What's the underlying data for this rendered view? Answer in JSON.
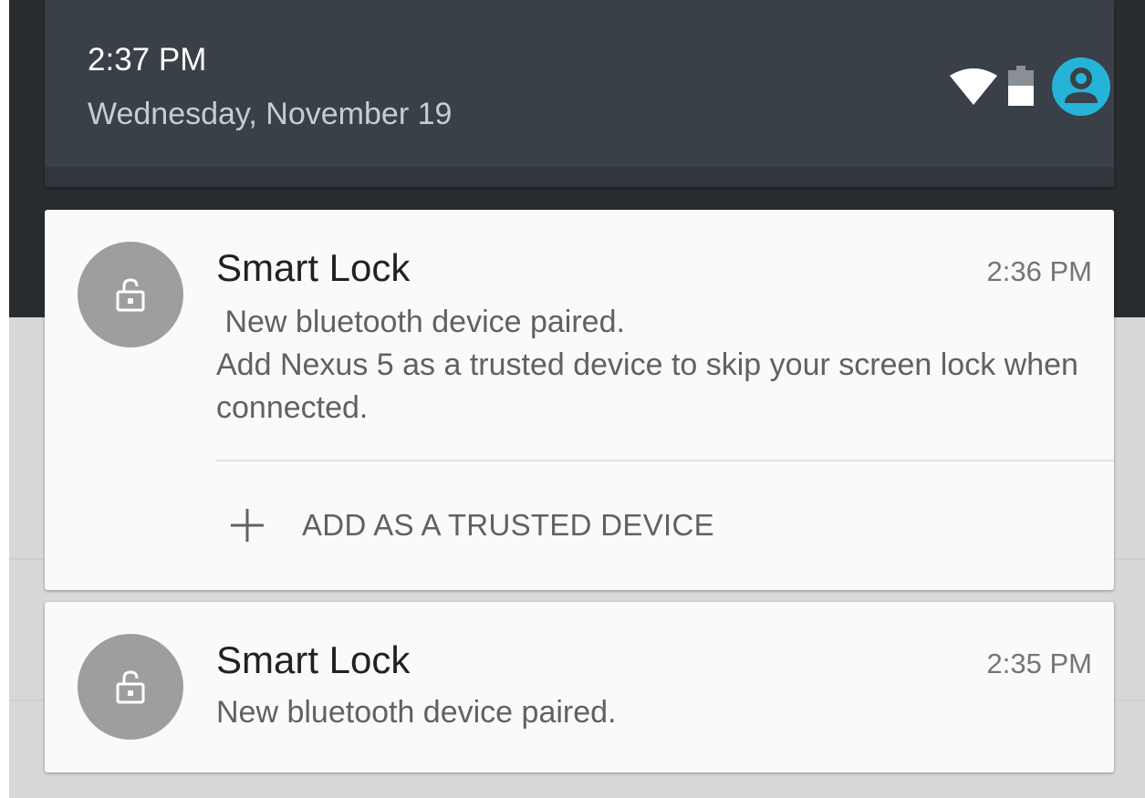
{
  "header": {
    "time": "2:37 PM",
    "date": "Wednesday, November 19",
    "icons": [
      "wifi-icon",
      "battery-icon",
      "user-avatar-icon"
    ],
    "accent_color": "#26b3d8"
  },
  "notifications": [
    {
      "app": "Smart Lock",
      "time": "2:36 PM",
      "icon": "unlocked-padlock-icon",
      "line1": " New bluetooth device paired.",
      "line2": "Add Nexus 5 as a trusted device to skip your screen lock when connected.",
      "action": {
        "icon": "plus-icon",
        "label": "ADD AS A TRUSTED DEVICE"
      }
    },
    {
      "app": "Smart Lock",
      "time": "2:35 PM",
      "icon": "unlocked-padlock-icon",
      "line1": "New bluetooth device paired."
    }
  ]
}
